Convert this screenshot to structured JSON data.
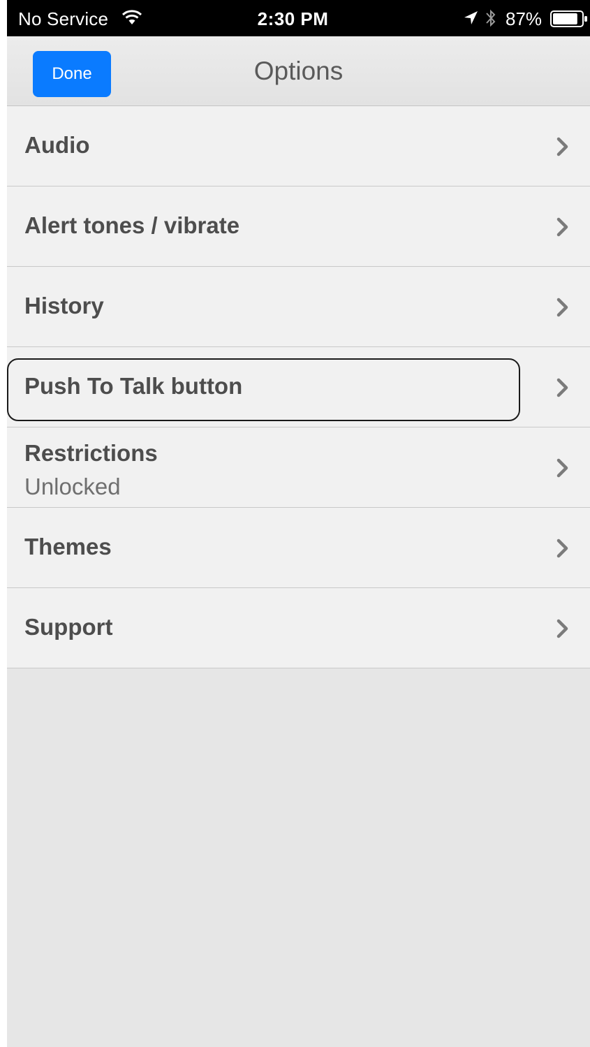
{
  "status_bar": {
    "carrier": "No Service",
    "time": "2:30 PM",
    "battery": "87%",
    "battery_level": 0.87,
    "icons": [
      "wifi-icon",
      "location-arrow-icon",
      "bluetooth-icon",
      "battery-icon"
    ]
  },
  "nav": {
    "done_label": "Done",
    "title": "Options"
  },
  "items": [
    {
      "label": "Audio"
    },
    {
      "label": "Alert tones / vibrate"
    },
    {
      "label": "History"
    },
    {
      "label": "Push To Talk button",
      "focused": true
    },
    {
      "label": "Restrictions",
      "sub": "Unlocked"
    },
    {
      "label": "Themes"
    },
    {
      "label": "Support"
    }
  ],
  "colors": {
    "accent": "#0a7bff",
    "row_background": "#f1f1f1",
    "screen_background": "#e6e6e6"
  }
}
